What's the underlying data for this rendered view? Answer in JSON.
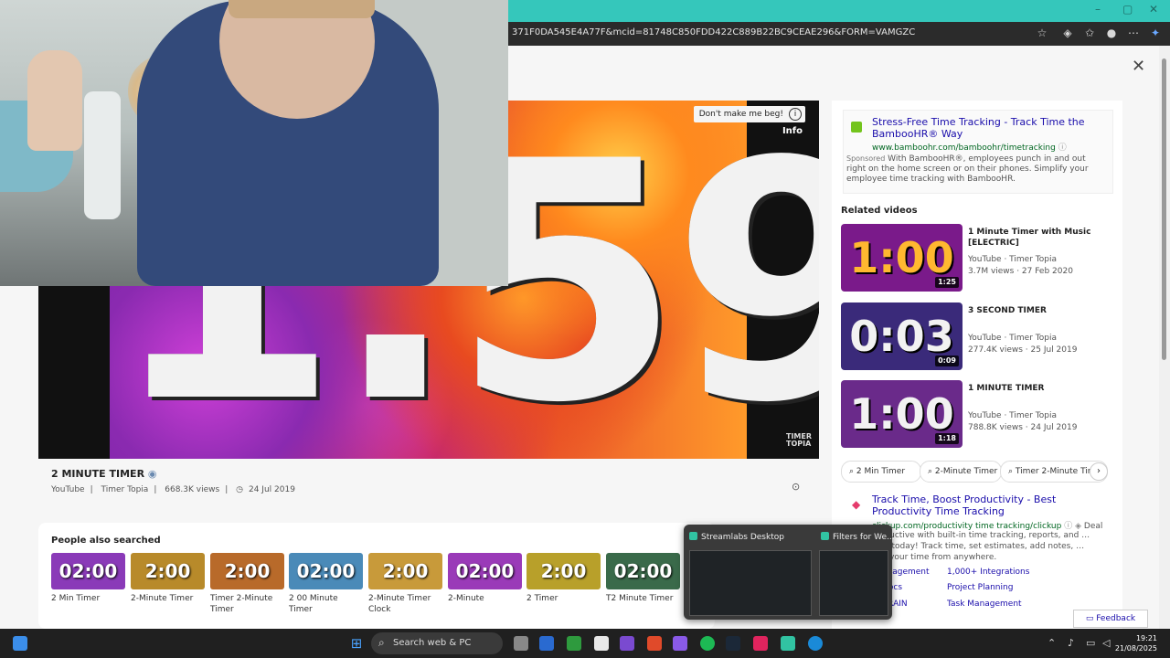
{
  "browser": {
    "url": "371F0DA545E4A77F&mcid=81748C850FDD422C889B22BC9CEAE296&FORM=VAMGZC",
    "window_controls": [
      "–",
      "▢",
      "✕"
    ]
  },
  "player": {
    "timer_display": "1:59",
    "dont_beg": "Don't make me beg!",
    "info_label": "Info",
    "watermark": "TIMER TOPIA"
  },
  "video": {
    "title": "2 MINUTE TIMER",
    "source": "YouTube",
    "channel": "Timer Topia",
    "views": "668.3K views",
    "date": "24 Jul 2019"
  },
  "people_also_searched": {
    "title": "People also searched",
    "items": [
      {
        "thumb": "02:00",
        "label": "2 Min Timer",
        "bg": "#8a3ab8"
      },
      {
        "thumb": "2:00",
        "label": "2-Minute Timer",
        "bg": "#b88a2a"
      },
      {
        "thumb": "2:00",
        "label": "Timer 2-Minute Timer",
        "bg": "#b86a2a"
      },
      {
        "thumb": "02:00",
        "label": "2 00 Minute Timer",
        "bg": "#4a8ab8"
      },
      {
        "thumb": "2:00",
        "label": "2-Minute Timer Clock",
        "bg": "#c89a3a"
      },
      {
        "thumb": "02:00",
        "label": "2-Minute",
        "bg": "#9a3ab8"
      },
      {
        "thumb": "2:00",
        "label": "2 Timer",
        "bg": "#b8a02a"
      },
      {
        "thumb": "02:00",
        "label": "T2 Minute Timer",
        "bg": "#3a6a4a"
      }
    ]
  },
  "ad1": {
    "title": "Stress-Free Time Tracking - Track Time the BambooHR® Way",
    "url": "www.bamboohr.com/bamboohr/timetracking",
    "sponsored": "Sponsored",
    "description": "With BambooHR®, employees punch in and out right on the home screen or on their phones. Simplify your employee time tracking with BambooHR."
  },
  "related": {
    "title": "Related videos",
    "items": [
      {
        "thumb": "1:00",
        "duration": "1:25",
        "title": "1 Minute Timer with Music [ELECTRIC]",
        "source": "YouTube · Timer Topia",
        "stats": "3.7M views · 27 Feb 2020",
        "bg": "#7a1a8a",
        "fg": "#ffb830"
      },
      {
        "thumb": "0:03",
        "duration": "0:09",
        "title": "3 SECOND TIMER",
        "source": "YouTube · Timer Topia",
        "stats": "277.4K views · 25 Jul 2019",
        "bg": "#3a2a7a",
        "fg": "#f2f2f2"
      },
      {
        "thumb": "1:00",
        "duration": "1:18",
        "title": "1 MINUTE TIMER",
        "source": "YouTube · Timer Topia",
        "stats": "788.8K views · 24 Jul 2019",
        "bg": "#6a2a8a",
        "fg": "#f2f2f2"
      }
    ]
  },
  "chips": [
    "2 Min Timer",
    "2-Minute Timer",
    "Timer 2-Minute Timer"
  ],
  "ad2": {
    "title": "Track Time, Boost Productivity - Best Productivity Time Tracking",
    "url": "clickup.com/productivity time tracking/clickup",
    "deal": "Deal",
    "description": "…ay productive with built-in time tracking, reports, and … Start free today! Track time, set estimates, add notes, …eports of your time from anywhere.",
    "links": [
      "…anagement",
      "1,000+ Integrations",
      "…Docs",
      "Project Planning",
      "…BRAIN",
      "Task Management"
    ]
  },
  "feedback": "Feedback",
  "taskbar_popup": {
    "items": [
      "Streamlabs Desktop",
      "Filters for We..."
    ]
  },
  "taskbar": {
    "search_placeholder": "Search web & PC",
    "time": "19:21",
    "date": "21/08/2025"
  }
}
